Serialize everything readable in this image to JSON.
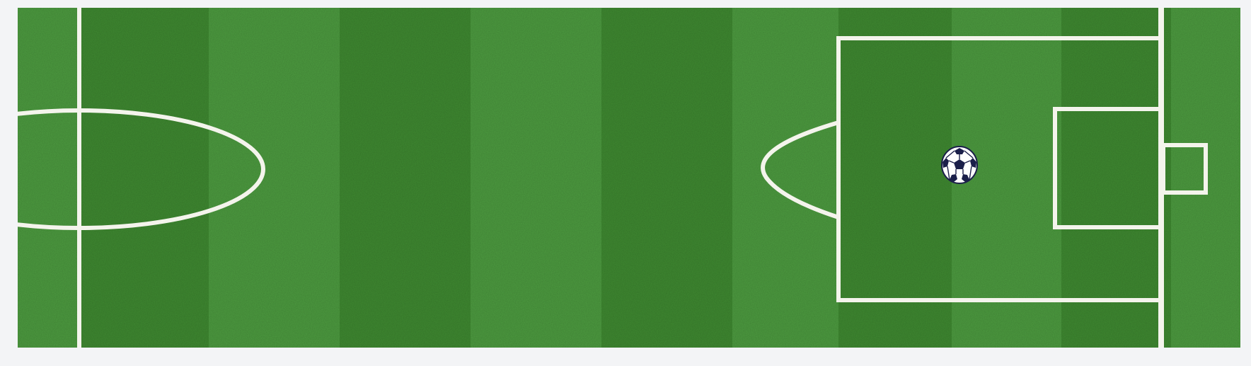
{
  "game": {
    "type": "soccer-pitch",
    "view": "right-half",
    "colors": {
      "page_background": "#f3f4f6",
      "grass_light": "#4d9c40",
      "grass_dark": "#3f8a31",
      "lines": "#f4f4ec",
      "ball_panels": "#1b1f4a",
      "ball_base": "#ffffff"
    },
    "ball": {
      "icon": "soccer-ball-icon"
    }
  }
}
